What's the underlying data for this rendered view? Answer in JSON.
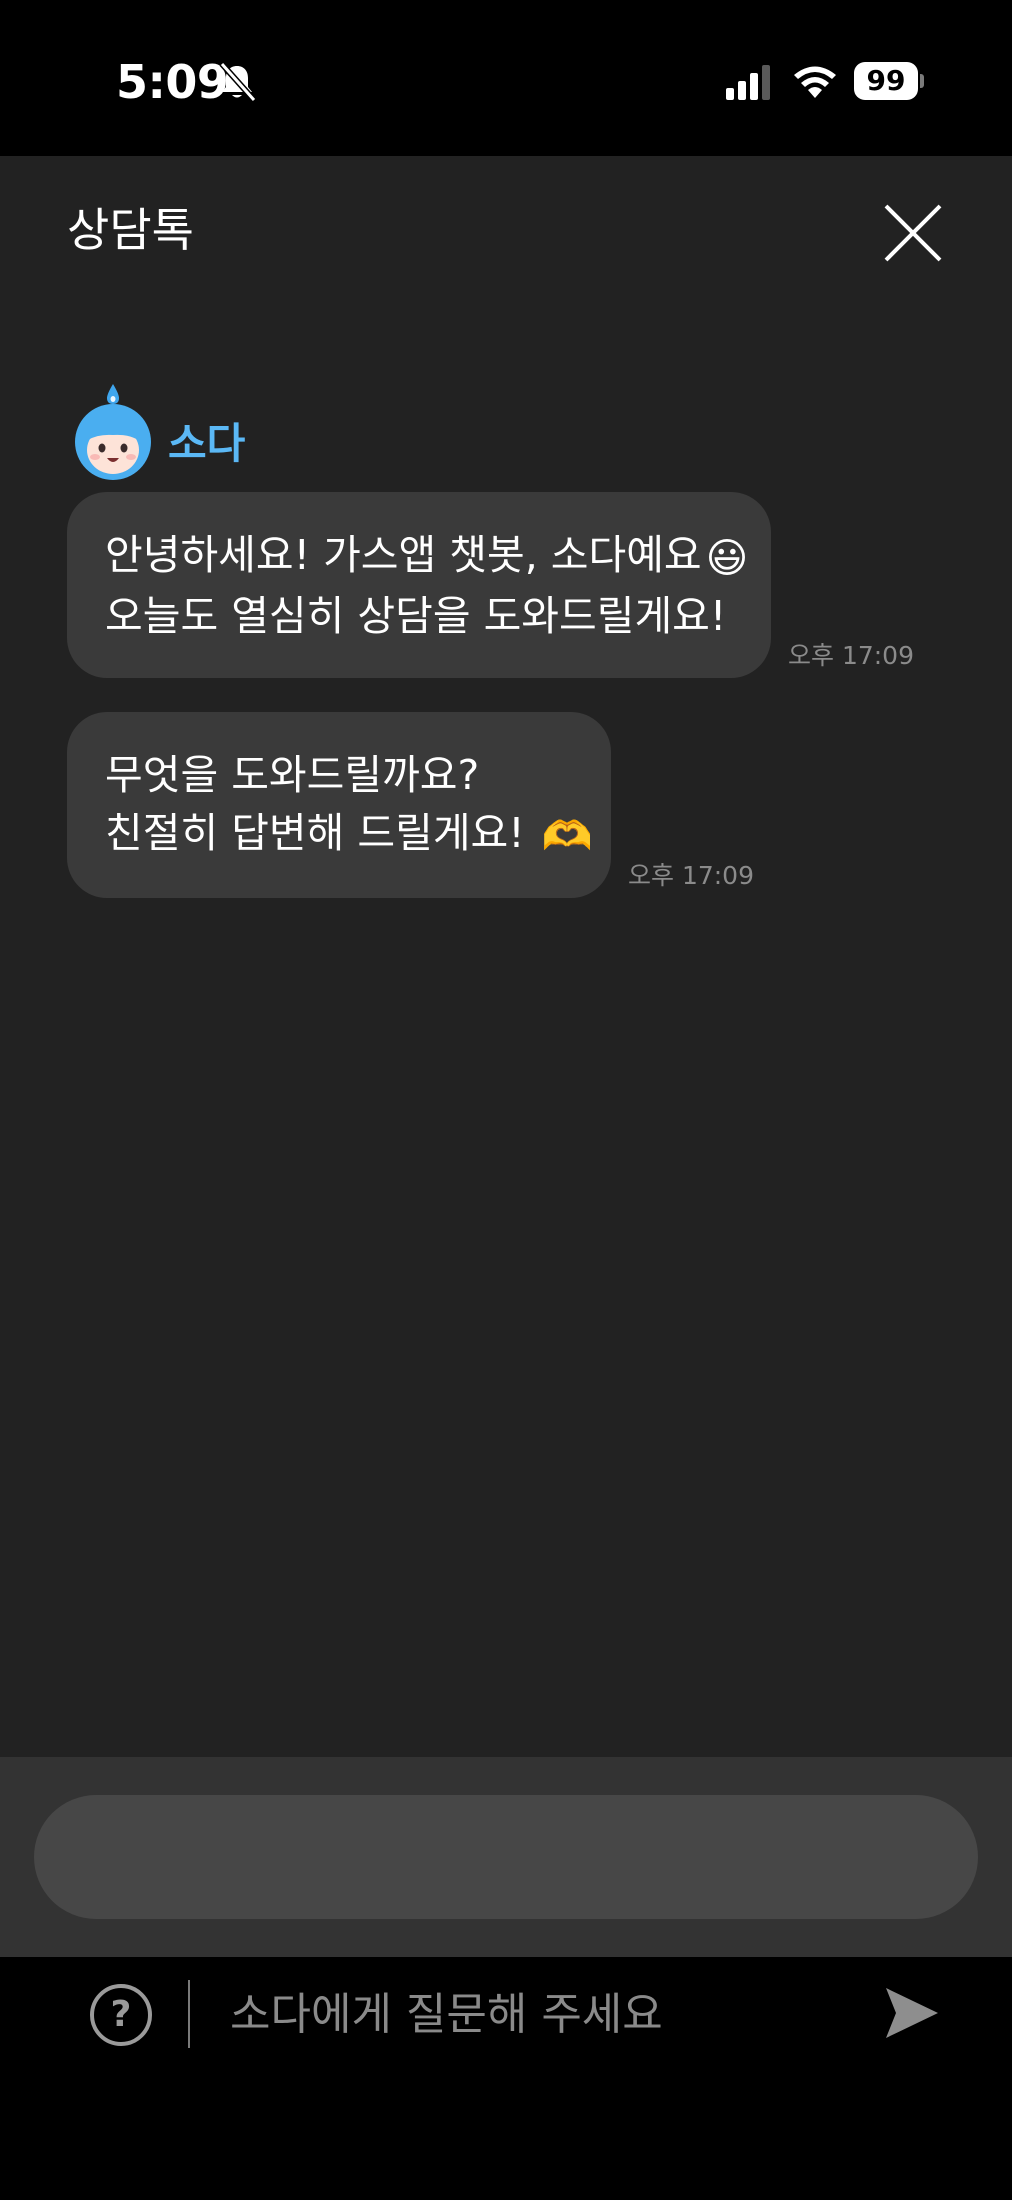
{
  "status_bar": {
    "time": "5:09",
    "battery": "99",
    "icons": [
      "bell-slash-icon",
      "signal-icon",
      "wifi-icon",
      "battery-icon"
    ]
  },
  "header": {
    "title": "상담톡",
    "close_icon": "close-icon"
  },
  "bot": {
    "name": "소다",
    "avatar_icon": "soda-avatar-icon",
    "name_color": "#5bb8f5"
  },
  "messages": [
    {
      "lines": [
        "안녕하세요! 가스앱 챗봇, 소다예요",
        "오늘도 열심히 상담을 도와드릴게요!"
      ],
      "emoji": "😃",
      "timestamp": "오후 17:09"
    },
    {
      "lines": [
        "무엇을 도와드릴까요?",
        "친절히 답변해 드릴게요! "
      ],
      "emoji": "🫶",
      "timestamp": "오후 17:09"
    }
  ],
  "composer": {
    "help_label": "?",
    "placeholder": "소다에게 질문해 주세요",
    "value": "",
    "send_icon": "send-icon"
  },
  "colors": {
    "background": "#222222",
    "bubble": "#3a3a3a",
    "composer_bar": "#333333",
    "composer_pill": "#474747"
  }
}
